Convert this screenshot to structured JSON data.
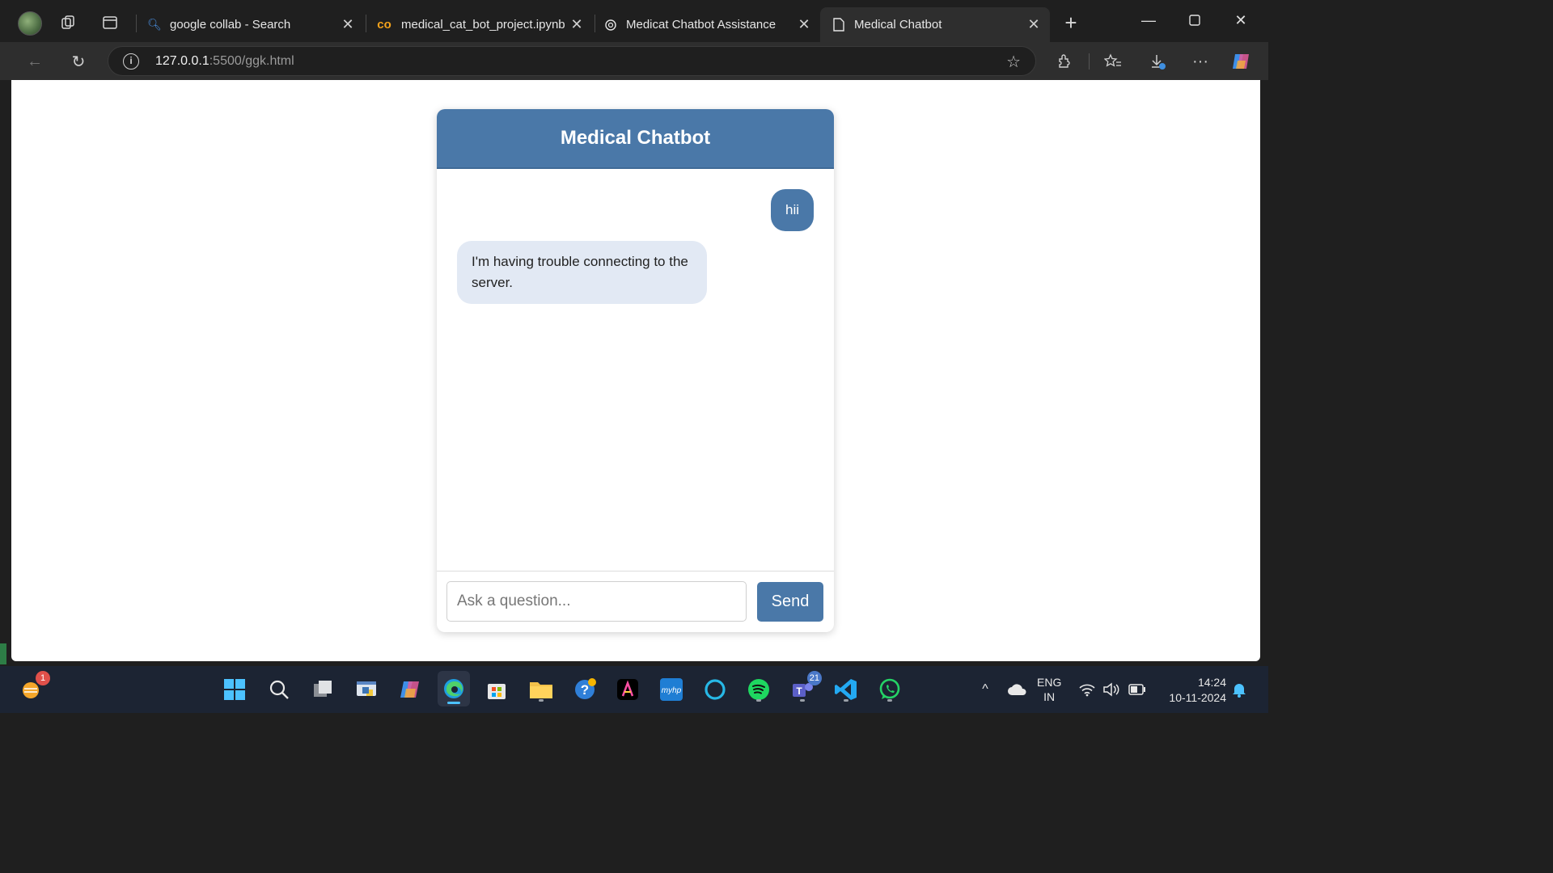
{
  "browser": {
    "tabs": [
      {
        "title": "google collab - Search",
        "icon": "search-icon"
      },
      {
        "title": "medical_cat_bot_project.ipynb -",
        "icon": "colab-icon"
      },
      {
        "title": "Medicat Chatbot Assistance",
        "icon": "chatgpt-icon"
      },
      {
        "title": "Medical Chatbot",
        "icon": "page-icon",
        "active": true
      }
    ],
    "address": {
      "host": "127.0.0.1",
      "rest": ":5500/ggk.html"
    }
  },
  "chat": {
    "title": "Medical Chatbot",
    "messages": [
      {
        "role": "user",
        "text": "hii"
      },
      {
        "role": "bot",
        "text": "I'm having trouble connecting to the server."
      }
    ],
    "input_placeholder": "Ask a question...",
    "send_label": "Send"
  },
  "taskbar": {
    "weather_badge": "1",
    "teams_badge": "21",
    "language": {
      "line1": "ENG",
      "line2": "IN"
    },
    "time": "14:24",
    "date": "10-11-2024"
  },
  "colors": {
    "accent": "#4a78a8",
    "bot_bubble": "#e2e9f4",
    "browser_dark": "#1f1f1f",
    "taskbar": "#1c2433"
  }
}
